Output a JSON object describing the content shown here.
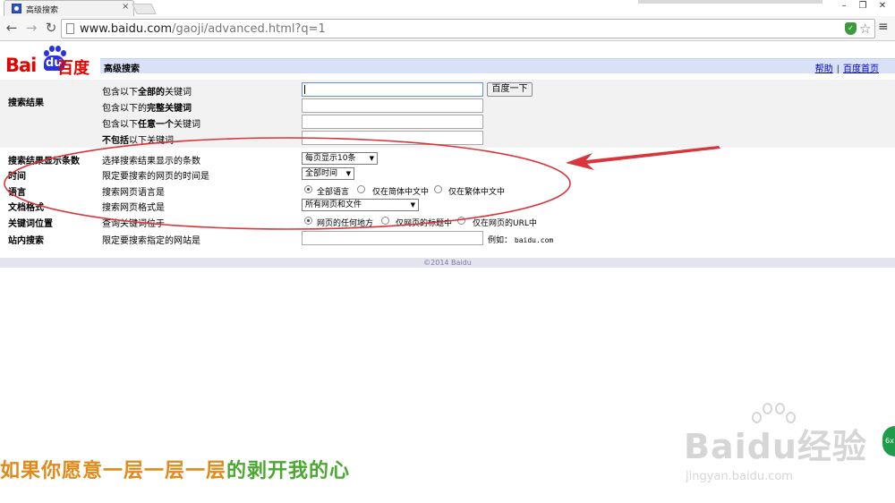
{
  "browser": {
    "tab_title": "高级搜索",
    "tab_close": "×",
    "url_host": "www.baidu.com",
    "url_path": "/gaoji/advanced.html?q=1",
    "window_controls": [
      "–",
      "❐",
      "✕"
    ]
  },
  "logo": {
    "text_en": "Bai",
    "text_du": "du",
    "text_cn": "百度",
    "brand_red": "#e10602",
    "brand_blue": "#2932e1"
  },
  "header": {
    "title": "高级搜索",
    "help": "帮助",
    "separator": "|",
    "home": "百度首页"
  },
  "search_results": {
    "section_label": "搜索结果",
    "rows": [
      {
        "pre": "包含以下",
        "bold": "全部的",
        "post": "关键词"
      },
      {
        "pre": "包含以下的",
        "bold": "完整关键词",
        "post": ""
      },
      {
        "pre": "包含以下",
        "bold": "任意一个",
        "post": "关键词"
      },
      {
        "pre": "",
        "bold": "不包括",
        "post": "以下关键词"
      }
    ],
    "search_button": "百度一下"
  },
  "options": [
    {
      "label": "搜索结果显示条数",
      "desc": "选择搜索结果显示的条数",
      "value": "每页显示10条"
    },
    {
      "label": "时间",
      "desc": "限定要搜索的网页的时间是",
      "value": "全部时间"
    },
    {
      "label": "语言",
      "desc": "搜索网页语言是",
      "radios": [
        "全部语言",
        "仅在简体中文中",
        "仅在繁体中文中"
      ]
    },
    {
      "label": "文档格式",
      "desc": "搜索网页格式是",
      "value": "所有网页和文件"
    },
    {
      "label": "关键词位置",
      "desc": "查询关键词位于",
      "radios": [
        "网页的任何地方",
        "仅网页的标题中",
        "仅在网页的URL中"
      ]
    },
    {
      "label": "站内搜索",
      "desc": "限定要搜索指定的网站是",
      "example_label": "例如：",
      "example_value": "baidu.com"
    }
  ],
  "footer": {
    "copyright": "©2014 Baidu"
  },
  "annotation_color": "#d9363b",
  "overlay": {
    "subtitle_part1": "如果你愿意一层一层一层",
    "subtitle_part2": "的剥开我的心",
    "watermark": "Baidu经验",
    "watermark_url": "jingyan.baidu.com",
    "badge": "6x"
  }
}
